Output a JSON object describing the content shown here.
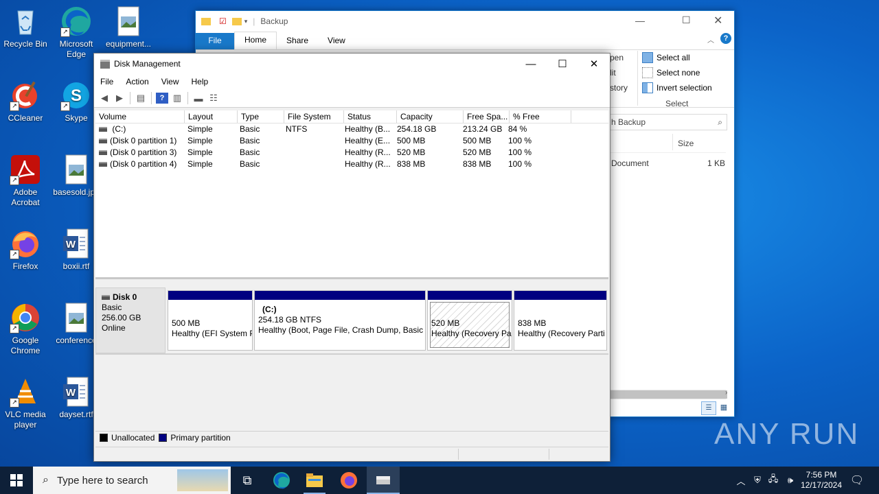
{
  "desktop": {
    "icons": [
      {
        "label": "Recycle Bin"
      },
      {
        "label": "Microsoft Edge"
      },
      {
        "label": "equipment..."
      },
      {
        "label": "CCleaner"
      },
      {
        "label": "Skype"
      },
      {
        "label": "Adobe Acrobat"
      },
      {
        "label": "basesold.jpg"
      },
      {
        "label": "Firefox"
      },
      {
        "label": "boxii.rtf"
      },
      {
        "label": "Google Chrome"
      },
      {
        "label": "conference"
      },
      {
        "label": "VLC media player"
      },
      {
        "label": "dayset.rtf"
      }
    ]
  },
  "explorer": {
    "title": "Backup",
    "tabs": [
      "File",
      "Home",
      "Share",
      "View"
    ],
    "select_group": {
      "select_all": "Select all",
      "select_none": "Select none",
      "invert": "Invert selection",
      "group_label": "Select"
    },
    "partial_labels": {
      "open": "pen",
      "edit": "lit",
      "history": "story"
    },
    "search_placeholder": "h Backup",
    "columns": {
      "size": "Size"
    },
    "file": {
      "name": "Document",
      "size": "1 KB"
    }
  },
  "disk_mgmt": {
    "title": "Disk Management",
    "menu": [
      "File",
      "Action",
      "View",
      "Help"
    ],
    "columns": [
      "Volume",
      "Layout",
      "Type",
      "File System",
      "Status",
      "Capacity",
      "Free Spa...",
      "% Free"
    ],
    "volumes": [
      {
        "volume": "(C:)",
        "layout": "Simple",
        "type": "Basic",
        "fs": "NTFS",
        "status": "Healthy (B...",
        "capacity": "254.18 GB",
        "free": "213.24 GB",
        "pct": "84 %"
      },
      {
        "volume": "(Disk 0 partition 1)",
        "layout": "Simple",
        "type": "Basic",
        "fs": "",
        "status": "Healthy (E...",
        "capacity": "500 MB",
        "free": "500 MB",
        "pct": "100 %"
      },
      {
        "volume": "(Disk 0 partition 3)",
        "layout": "Simple",
        "type": "Basic",
        "fs": "",
        "status": "Healthy (R...",
        "capacity": "520 MB",
        "free": "520 MB",
        "pct": "100 %"
      },
      {
        "volume": "(Disk 0 partition 4)",
        "layout": "Simple",
        "type": "Basic",
        "fs": "",
        "status": "Healthy (R...",
        "capacity": "838 MB",
        "free": "838 MB",
        "pct": "100 %"
      }
    ],
    "disk": {
      "name": "Disk 0",
      "type": "Basic",
      "size": "256.00 GB",
      "state": "Online"
    },
    "partitions": [
      {
        "line1": "500 MB",
        "line2": "Healthy (EFI System P"
      },
      {
        "title": "(C:)",
        "line1": "254.18 GB NTFS",
        "line2": "Healthy (Boot, Page File, Crash Dump, Basic D"
      },
      {
        "line1": "520 MB",
        "line2": "Healthy (Recovery Pa"
      },
      {
        "line1": "838 MB",
        "line2": "Healthy (Recovery Parti"
      }
    ],
    "legend": {
      "unallocated": "Unallocated",
      "primary": "Primary partition"
    },
    "colors": {
      "primary": "#000080",
      "unallocated": "#000000"
    }
  },
  "taskbar": {
    "search_placeholder": "Type here to search",
    "time": "7:56 PM",
    "date": "12/17/2024"
  },
  "watermark": "ANY RUN"
}
